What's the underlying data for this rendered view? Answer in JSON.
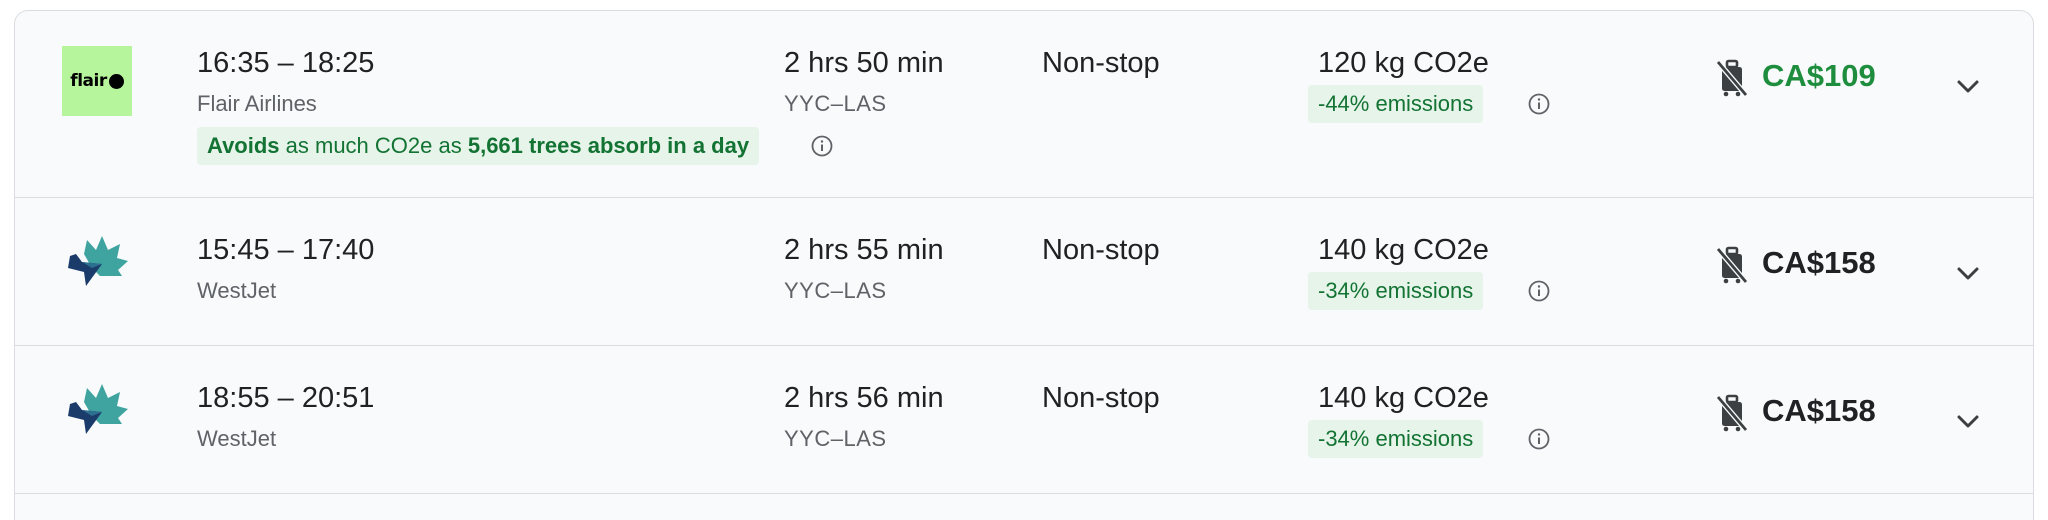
{
  "flights": [
    {
      "logo": "flair-logo",
      "logo_text": "flair",
      "times": "16:35 – 18:25",
      "airline": "Flair Airlines",
      "duration": "2 hrs 50 min",
      "route": "YYC–LAS",
      "stops": "Non-stop",
      "emissions": "120 kg CO2e",
      "emissions_badge": "-44% emissions",
      "price": "CA$109",
      "price_color": "#1e8e3e",
      "eco_banner": {
        "part1": "Avoids",
        "part2": " as much CO2e as ",
        "part3": "5,661 trees absorb in a day"
      }
    },
    {
      "logo": "westjet-logo",
      "times": "15:45 – 17:40",
      "airline": "WestJet",
      "duration": "2 hrs 55 min",
      "route": "YYC–LAS",
      "stops": "Non-stop",
      "emissions": "140 kg CO2e",
      "emissions_badge": "-34% emissions",
      "price": "CA$158"
    },
    {
      "logo": "westjet-logo",
      "times": "18:55 – 20:51",
      "airline": "WestJet",
      "duration": "2 hrs 56 min",
      "route": "YYC–LAS",
      "stops": "Non-stop",
      "emissions": "140 kg CO2e",
      "emissions_badge": "-34% emissions",
      "price": "CA$158"
    }
  ],
  "icons": {
    "info": "info-icon",
    "no_carry_on": "no-carry-on-bag-icon",
    "expand": "chevron-down-icon"
  },
  "colors": {
    "eco_green": "#137333",
    "eco_bg": "#e6f4ea",
    "cheap_price": "#1e8e3e",
    "row_bg": "#f8fafb",
    "border": "#dadce0"
  }
}
